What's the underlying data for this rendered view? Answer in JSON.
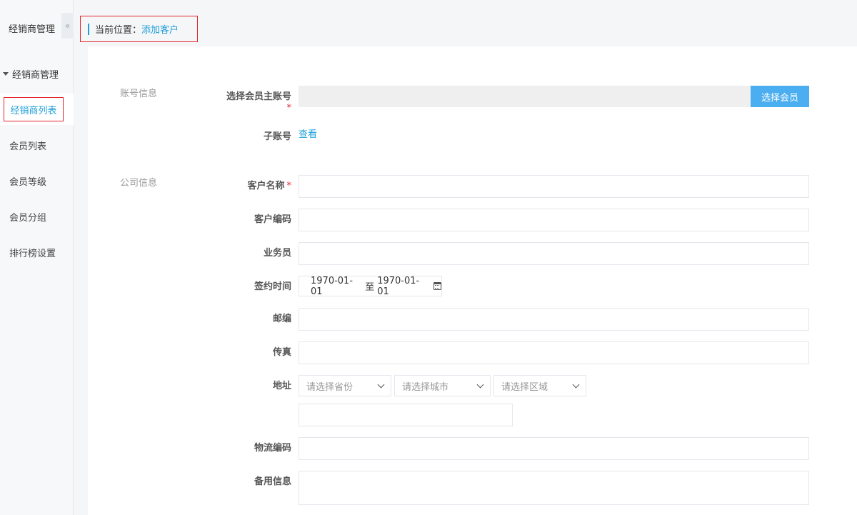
{
  "sidebar": {
    "title": "经销商管理",
    "collapse_icon": "«",
    "group_label": "经销商管理",
    "items": [
      {
        "label": "经销商列表",
        "active": true
      },
      {
        "label": "会员列表"
      },
      {
        "label": "会员等级"
      },
      {
        "label": "会员分组"
      },
      {
        "label": "排行榜设置"
      }
    ]
  },
  "breadcrumb": {
    "label": "当前位置：",
    "current": "添加客户"
  },
  "form": {
    "section_account": "账号信息",
    "section_company": "公司信息",
    "member_label": "选择会员主账号",
    "member_button": "选择会员",
    "sub_account_label": "子账号",
    "sub_account_link": "查看",
    "customer_name_label": "客户名称",
    "customer_code_label": "客户编码",
    "salesman_label": "业务员",
    "sign_time_label": "签约时间",
    "sign_time_start": "1970-01-01",
    "sign_time_sep": "至",
    "sign_time_end": "1970-01-01",
    "postcode_label": "邮编",
    "fax_label": "传真",
    "address_label": "地址",
    "province_placeholder": "请选择省份",
    "city_placeholder": "请选择城市",
    "district_placeholder": "请选择区域",
    "logistics_code_label": "物流编码",
    "remark_label": "备用信息",
    "required_mark": "*"
  },
  "colors": {
    "accent": "#1e9fd8",
    "primary_button": "#4aaef0",
    "highlight_border": "#e2262e"
  }
}
